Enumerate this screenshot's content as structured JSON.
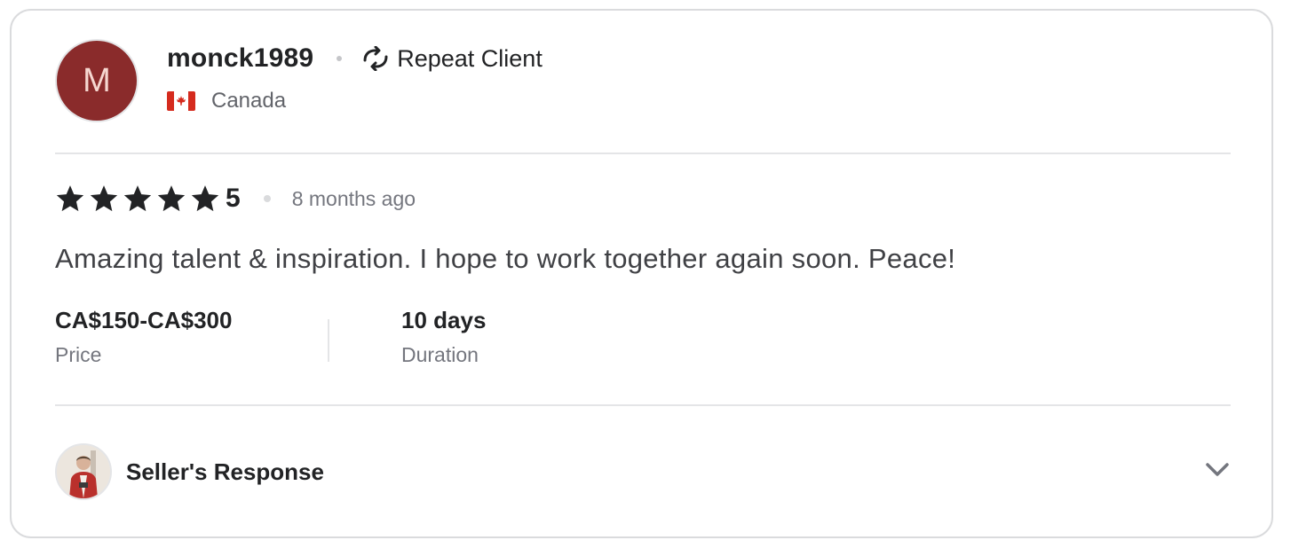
{
  "review": {
    "avatar_initial": "M",
    "username": "monck1989",
    "badge_label": "Repeat Client",
    "country": "Canada",
    "rating_value": "5",
    "rating_stars": 5,
    "time_ago": "8 months ago",
    "comment": "Amazing talent & inspiration. I hope to work together again soon. Peace!",
    "price_value": "CA$150-CA$300",
    "price_label": "Price",
    "duration_value": "10 days",
    "duration_label": "Duration",
    "seller_response_label": "Seller's Response"
  },
  "icons": {
    "repeat": "repeat-icon",
    "flag": "canada-flag-icon",
    "star": "star-icon",
    "chevron": "chevron-down-icon"
  },
  "colors": {
    "avatar_bg": "#8a2b2b",
    "star": "#222325",
    "muted_text": "#74767e",
    "border": "#dadbdd"
  }
}
